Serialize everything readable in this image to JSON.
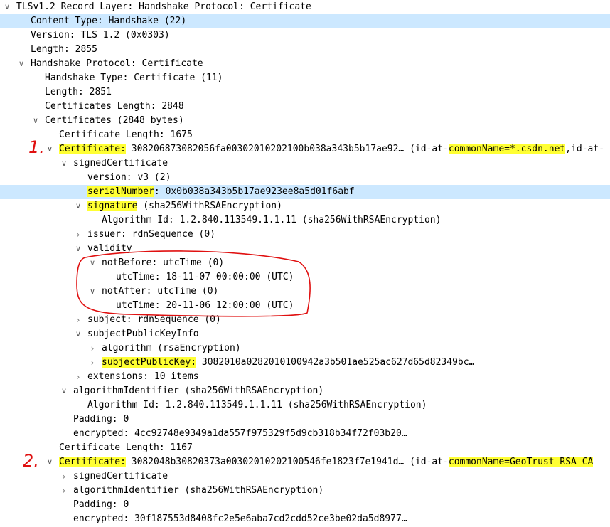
{
  "tree": {
    "r1": "TLSv1.2 Record Layer: Handshake Protocol: Certificate",
    "r2": "Content Type: Handshake (22)",
    "r3": "Version: TLS 1.2 (0x0303)",
    "r4": "Length: 2855",
    "r5": "Handshake Protocol: Certificate",
    "r6": "Handshake Type: Certificate (11)",
    "r7": "Length: 2851",
    "r8": "Certificates Length: 2848",
    "r9": "Certificates (2848 bytes)",
    "r10": "Certificate Length: 1675",
    "r11": {
      "label": "Certificate:",
      "value": " 308206873082056fa00302010202100b038a343b5b17ae92… (id-at-",
      "hl": "commonName=*.csdn.net",
      "tail": ",id-at-"
    },
    "r12": "signedCertificate",
    "r13": "version: v3 (2)",
    "r14": {
      "label": "serialNumber",
      "value": ": 0x0b038a343b5b17ae923ee8a5d01f6abf"
    },
    "r15": {
      "label": "signature",
      "value": " (sha256WithRSAEncryption)"
    },
    "r16": "Algorithm Id: 1.2.840.113549.1.1.11 (sha256WithRSAEncryption)",
    "r17": "issuer: rdnSequence (0)",
    "r18": "validity",
    "r19": "notBefore: utcTime (0)",
    "r20": "utcTime: 18-11-07 00:00:00 (UTC)",
    "r21": "notAfter: utcTime (0)",
    "r22": "utcTime: 20-11-06 12:00:00 (UTC)",
    "r23": "subject: rdnSequence (0)",
    "r24": "subjectPublicKeyInfo",
    "r25": "algorithm (rsaEncryption)",
    "r26": {
      "label": "subjectPublicKey:",
      "value": " 3082010a0282010100942a3b501ae525ac627d65d82349bc…"
    },
    "r27": "extensions: 10 items",
    "r28": "algorithmIdentifier (sha256WithRSAEncryption)",
    "r29": "Algorithm Id: 1.2.840.113549.1.1.11 (sha256WithRSAEncryption)",
    "r30": "Padding: 0",
    "r31": "encrypted: 4cc92748e9349a1da557f975329f5d9cb318b34f72f03b20…",
    "r32": "Certificate Length: 1167",
    "r33": {
      "label": "Certificate:",
      "value": " 3082048b30820373a00302010202100546fe1823f7e1941d… (id-at-",
      "hl": "commonName=GeoTrust RSA CA"
    },
    "r34": "signedCertificate",
    "r35": "algorithmIdentifier (sha256WithRSAEncryption)",
    "r36": "Padding: 0",
    "r37": "encrypted: 30f187553d8408fc2e5e6aba7cd2cdd52ce3be02da5d8977…"
  },
  "annotations": {
    "one": "1.",
    "two": "2."
  },
  "colors": {
    "selected": "#cce8ff",
    "highlight": "#ffff33",
    "annotation": "#e01010"
  }
}
